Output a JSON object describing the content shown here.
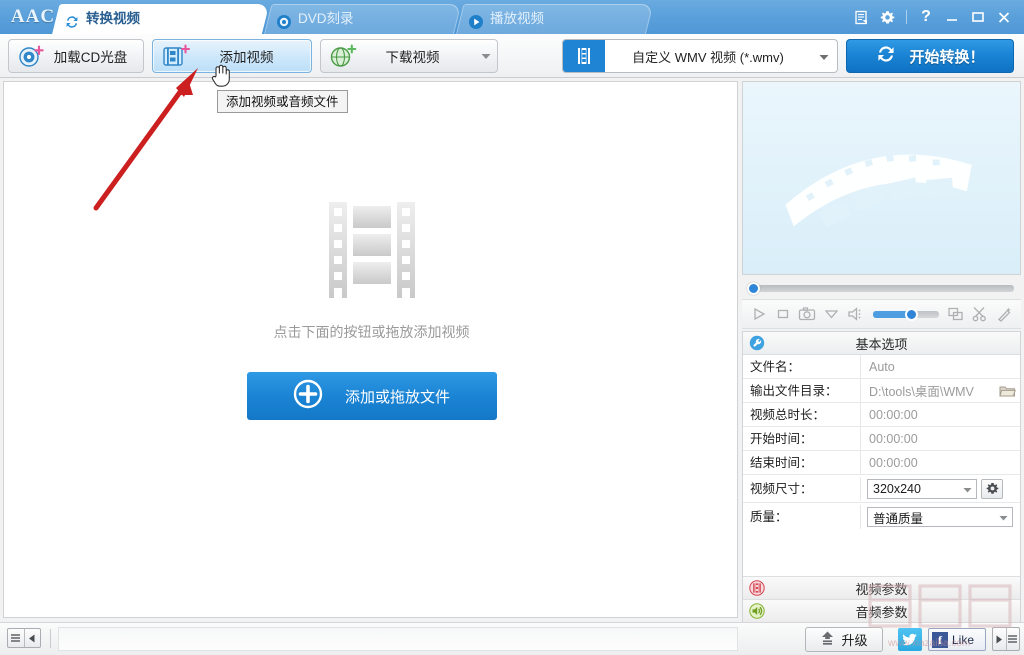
{
  "window": {
    "logo_text": "AAC",
    "controls": [
      {
        "name": "log-icon",
        "label": "log"
      },
      {
        "name": "gear-icon",
        "label": "settings"
      },
      {
        "name": "help-icon",
        "label": "?"
      },
      {
        "name": "minimize-icon",
        "label": "minimize"
      },
      {
        "name": "maximize-icon",
        "label": "maximize"
      },
      {
        "name": "close-icon",
        "label": "close"
      }
    ]
  },
  "tabs": [
    {
      "label": "转换视频",
      "icon": "convert-icon",
      "active": true
    },
    {
      "label": "DVD刻录",
      "icon": "disc-icon",
      "active": false
    },
    {
      "label": "播放视频",
      "icon": "play-icon",
      "active": false
    }
  ],
  "toolbar": {
    "load_cd_label": "加载CD光盘",
    "add_video_label": "添加视频",
    "download_video_label": "下载视频",
    "format_value": "自定义 WMV 视频 (*.wmv)",
    "convert_label": "开始转换！"
  },
  "tooltip": {
    "text": "添加视频或音频文件"
  },
  "dropzone": {
    "hint": "点击下面的按钮或拖放添加视频",
    "button_label": "添加或拖放文件"
  },
  "options": {
    "header": "基本选项",
    "rows": [
      {
        "label": "文件名：",
        "value": "Auto",
        "type": "text"
      },
      {
        "label": "输出文件目录：",
        "value": "D:\\tools\\桌面\\WMV",
        "type": "folder"
      },
      {
        "label": "视频总时长：",
        "value": "00:00:00",
        "type": "text"
      },
      {
        "label": "开始时间：",
        "value": "00:00:00",
        "type": "text"
      },
      {
        "label": "结束时间：",
        "value": "00:00:00",
        "type": "text"
      },
      {
        "label": "视频尺寸：",
        "value": "320x240",
        "type": "select-gear"
      },
      {
        "label": "质量：",
        "value": "普通质量",
        "type": "select"
      }
    ],
    "sections": [
      {
        "label": "视频参数",
        "icon": "video-params-icon"
      },
      {
        "label": "音频参数",
        "icon": "audio-params-icon"
      }
    ]
  },
  "statusbar": {
    "upgrade_label": "升级",
    "facebook_label": "Like",
    "facebook_mark": "f"
  },
  "watermark": {
    "text": "下载吧",
    "url": "www.xiazaiba.com"
  },
  "colors": {
    "titlebar": "#5aa0db",
    "accent_blue": "#1b84d4",
    "hover_blue": "#cfe8fb",
    "preview_bg": "#e2f2fb",
    "annotation_red": "#cc1f1f"
  }
}
